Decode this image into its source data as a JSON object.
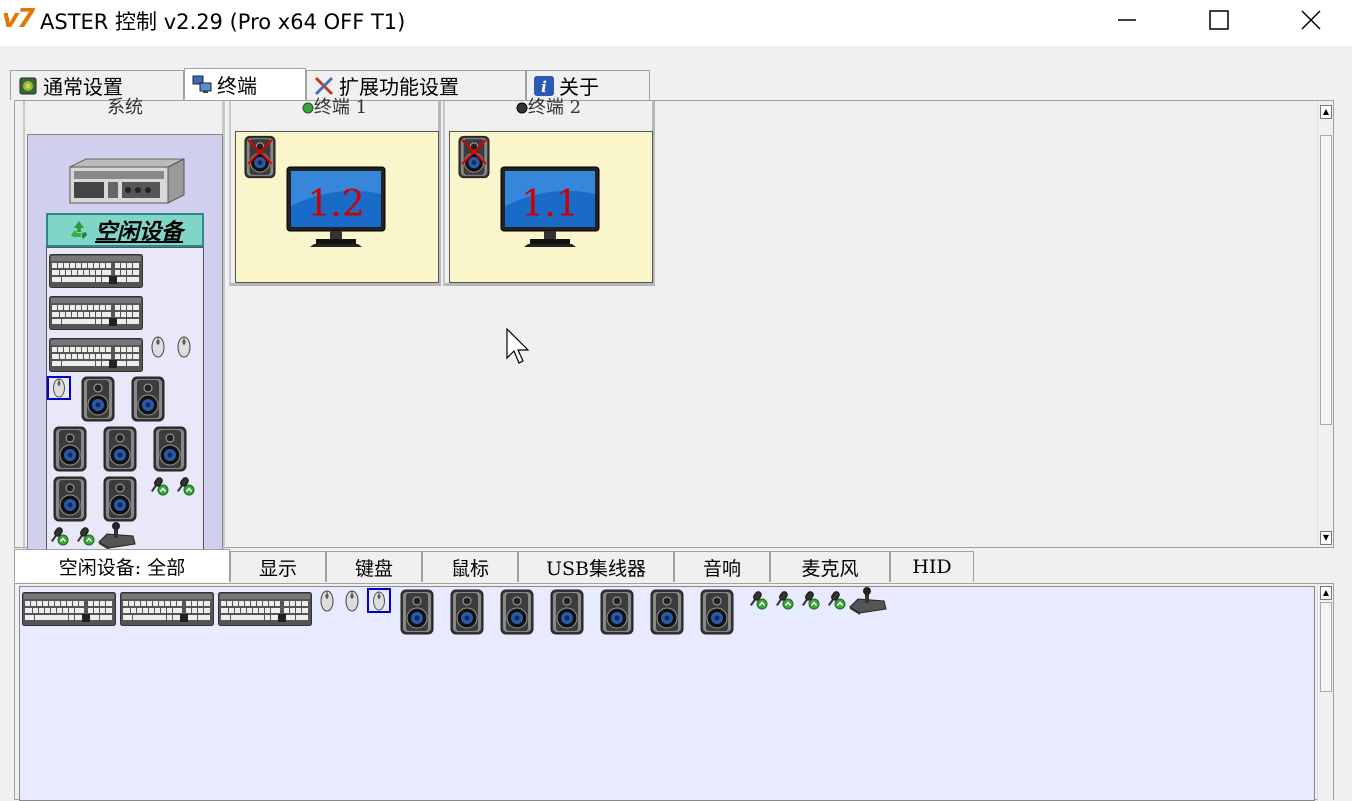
{
  "window": {
    "logo": "v7",
    "title": "ASTER 控制 v2.29 (Pro x64 OFF T1)",
    "controls": [
      "minimize",
      "maximize",
      "close"
    ]
  },
  "top_tabs": [
    {
      "label": "通常设置",
      "icon": "settings-icon",
      "active": false
    },
    {
      "label": "终端",
      "icon": "terminal-icon",
      "active": true
    },
    {
      "label": "扩展功能设置",
      "icon": "tools-icon",
      "active": false
    },
    {
      "label": "关于",
      "icon": "info-icon",
      "active": false
    }
  ],
  "system_panel": {
    "label": "系统",
    "idle_badge": "空闲设备"
  },
  "terminals": [
    {
      "label": "终端 1",
      "status": "online",
      "status_color": "#3aa63a",
      "screen_label": "1.2"
    },
    {
      "label": "终端 2",
      "status": "offline",
      "status_color": "#333333",
      "screen_label": "1.1"
    }
  ],
  "bottom_tabs": [
    {
      "label": "空闲设备: 全部",
      "active": true
    },
    {
      "label": "显示",
      "active": false
    },
    {
      "label": "键盘",
      "active": false
    },
    {
      "label": "鼠标",
      "active": false
    },
    {
      "label": "USB集线器",
      "active": false
    },
    {
      "label": "音响",
      "active": false
    },
    {
      "label": "麦克风",
      "active": false
    },
    {
      "label": "HID",
      "active": false
    }
  ],
  "colors": {
    "idle_badge_bg": "#7fd6c8",
    "system_box_bg": "#d0d0ee",
    "terminal_screen_bg": "#fbf5cc",
    "device_list_bg": "#e8eaff",
    "monitor_number": "#cc0000",
    "selected_border": "#0000cc"
  }
}
